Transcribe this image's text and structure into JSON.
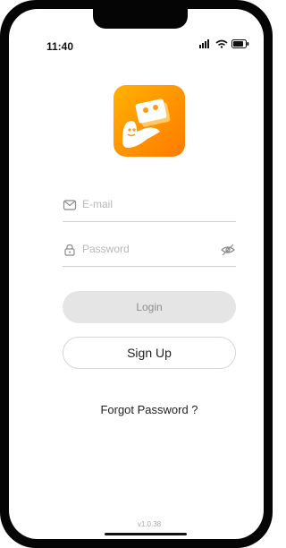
{
  "status_bar": {
    "time": "11:40"
  },
  "login_form": {
    "email_placeholder": "E-mail",
    "password_placeholder": "Password"
  },
  "buttons": {
    "login": "Login",
    "signup": "Sign Up"
  },
  "links": {
    "forgot_password": "Forgot Password ?"
  },
  "footer": {
    "version": "v1.0.38"
  },
  "colors": {
    "logo_gradient_start": "#FFB100",
    "logo_gradient_end": "#FF7A00",
    "button_disabled_bg": "#E5E5E5",
    "text_muted": "#B8B8B8"
  },
  "icons": {
    "email": "mail-icon",
    "password": "lock-icon",
    "password_toggle": "eye-off-icon",
    "signal": "signal-icon",
    "wifi": "wifi-icon",
    "battery": "battery-icon",
    "logo": "app-logo-icon"
  }
}
